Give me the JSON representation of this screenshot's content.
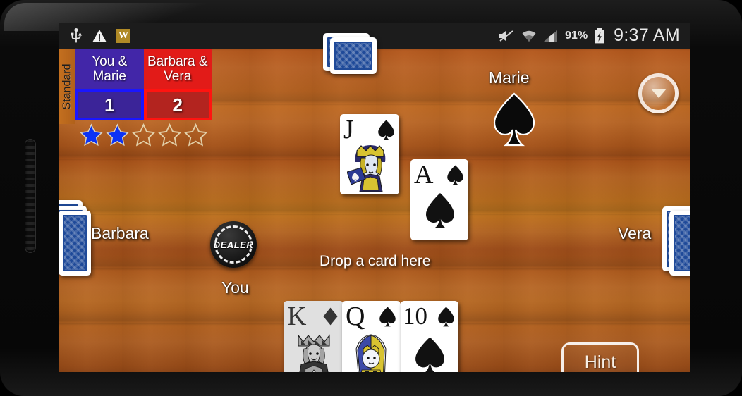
{
  "statusbar": {
    "icons": [
      "usb-icon",
      "warning-icon",
      "w-app-icon",
      "mute-icon",
      "wifi-icon",
      "signal-icon"
    ],
    "w_badge": "W",
    "battery_percent": "91%",
    "time": "9:37 AM"
  },
  "scoreboard": {
    "mode_label": "Standard",
    "teams": [
      {
        "name": "You &\nMarie",
        "name_line1": "You &",
        "name_line2": "Marie",
        "score": "1",
        "color": "#4226a8",
        "border": "#1a16ff"
      },
      {
        "name": "Barbara &\nVera",
        "name_line1": "Barbara &",
        "name_line2": "Vera",
        "score": "2",
        "color": "#e21b18",
        "border": "#ff1410"
      }
    ],
    "stars_total": 5,
    "stars_filled": 2,
    "star_fill_color": "#0b32f5"
  },
  "players": {
    "top": "Marie",
    "left": "Barbara",
    "right": "Vera",
    "bottom": "You"
  },
  "trump": {
    "suit": "spades",
    "symbol": "♠"
  },
  "dealer": {
    "label": "DEALER",
    "is": "You"
  },
  "table": {
    "drop_hint": "Drop a card here",
    "felt_color": "#b4581d"
  },
  "played_cards": [
    {
      "rank": "J",
      "suit": "♠",
      "suit_name": "spades",
      "color": "black",
      "face_card": true,
      "owner": "Marie"
    },
    {
      "rank": "A",
      "suit": "♠",
      "suit_name": "spades",
      "color": "black",
      "face_card": false,
      "owner": "Vera"
    }
  ],
  "hand": [
    {
      "rank": "K",
      "suit": "♦",
      "suit_name": "diamonds",
      "color": "red",
      "face_card": true,
      "playable": false
    },
    {
      "rank": "Q",
      "suit": "♠",
      "suit_name": "spades",
      "color": "black",
      "face_card": true,
      "playable": true
    },
    {
      "rank": "10",
      "suit": "♠",
      "suit_name": "spades",
      "color": "black",
      "face_card": false,
      "playable": true
    }
  ],
  "buttons": {
    "hint_label": "Hint",
    "menu_icon": "chevron-down-icon"
  }
}
